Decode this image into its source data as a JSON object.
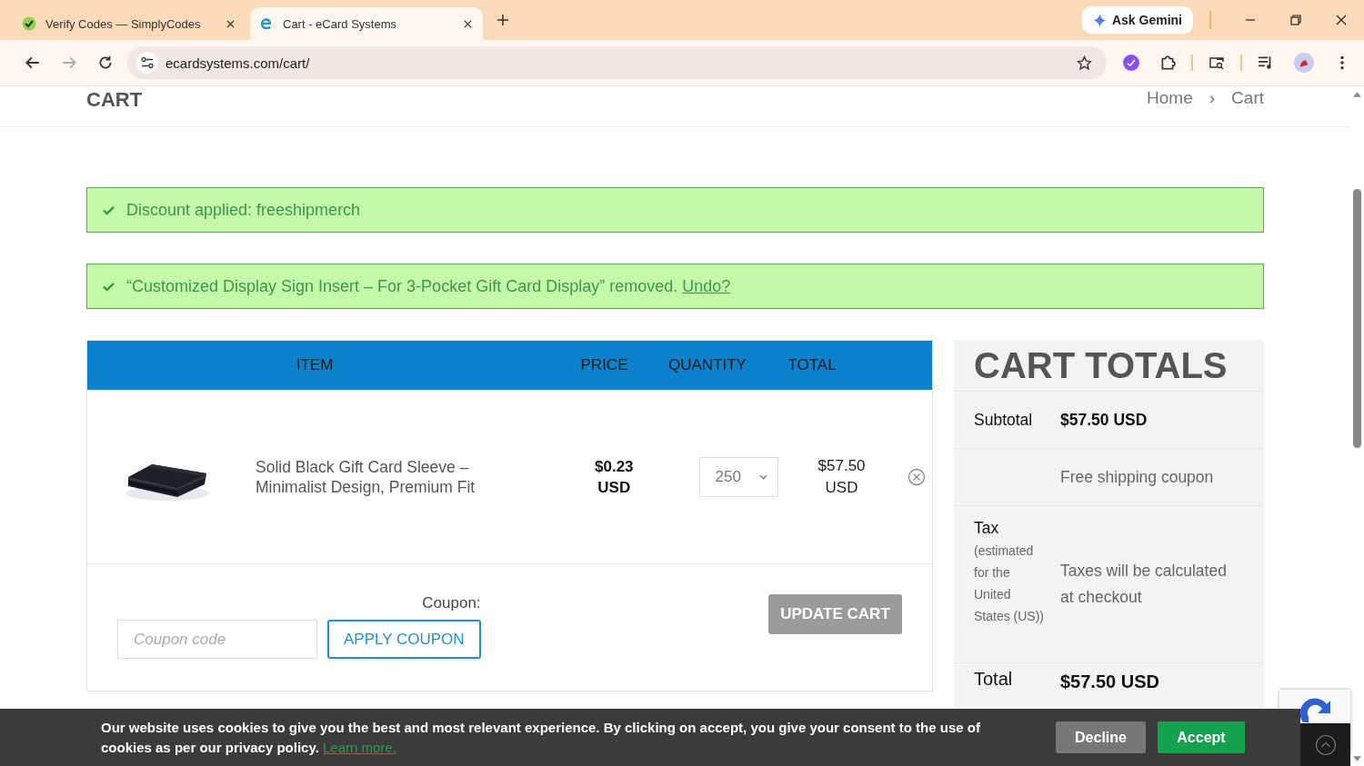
{
  "browser": {
    "tabs": [
      {
        "title": "Verify Codes — SimplyCodes",
        "selected": false,
        "kind": "simplycodes"
      },
      {
        "title": "Cart - eCard Systems",
        "selected": true,
        "kind": "ecard"
      }
    ],
    "ask_gemini": "Ask Gemini",
    "address": "ecardsystems.com/cart/",
    "forward_disabled": true
  },
  "page": {
    "header": {
      "title": "CART",
      "breadcrumb": [
        "Home",
        "Cart"
      ],
      "separator": "›"
    },
    "notices": [
      {
        "text": "Discount applied: freeshipmerch"
      },
      {
        "text": "“Customized Display Sign Insert – For 3-Pocket Gift Card Display” removed.",
        "link": "Undo?"
      }
    ],
    "cart_table": {
      "columns": [
        "ITEM",
        "PRICE",
        "QUANTITY",
        "TOTAL"
      ],
      "rows": [
        {
          "name": "Solid Black Gift Card Sleeve – Minimalist Design, Premium Fit",
          "price": "$0.23 USD",
          "quantity": "250",
          "total": "$57.50 USD"
        }
      ],
      "coupon": {
        "label": "Coupon:",
        "placeholder": "Coupon code",
        "apply": "APPLY COUPON"
      },
      "update": {
        "label": "UPDATE CART",
        "disabled": true
      }
    },
    "totals": {
      "title": "CART TOTALS",
      "rows": [
        {
          "kind": "subtotal",
          "label": "Subtotal",
          "value": "$57.50 USD"
        },
        {
          "kind": "note",
          "value": "Free shipping coupon"
        },
        {
          "kind": "tax",
          "label": "Tax",
          "note": "(estimated for the United States (US))",
          "value": "Taxes will be calculated at checkout"
        },
        {
          "kind": "total",
          "label": "Total",
          "value": "$57.50 USD"
        }
      ]
    }
  },
  "cookie_bar": {
    "text": "Our website uses cookies to give you the best and most relevant experience. By clicking on accept, you give your consent to the use of cookies as per our privacy policy.",
    "link": "Learn more.",
    "decline": "Decline",
    "accept": "Accept"
  }
}
